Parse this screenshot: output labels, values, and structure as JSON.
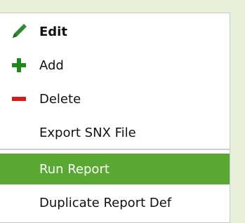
{
  "colors": {
    "background": "#e8f0dc",
    "menu_background": "#ffffff",
    "selected_background": "#58a832",
    "add_icon": "#1e8a1e",
    "delete_icon": "#d61b1b",
    "edit_icon": "#2f8a2f"
  },
  "menu": {
    "items": [
      {
        "label": "Edit",
        "icon": "pencil-icon"
      },
      {
        "label": "Add",
        "icon": "plus-icon"
      },
      {
        "label": "Delete",
        "icon": "minus-icon"
      },
      {
        "label": "Export SNX File",
        "icon": ""
      },
      {
        "label": "Run Report",
        "icon": "",
        "selected": true
      },
      {
        "label": "Duplicate Report Def",
        "icon": ""
      }
    ]
  }
}
